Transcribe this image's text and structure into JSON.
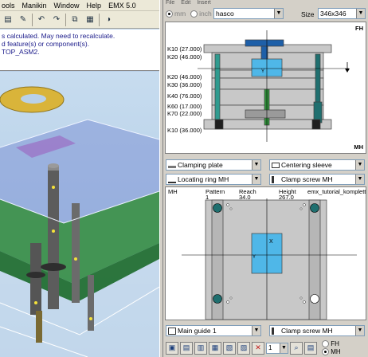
{
  "creo": {
    "menu": [
      "ools",
      "Manikin",
      "Window",
      "Help",
      "EMX 5.0"
    ],
    "messages": [
      "s calculated. May need to recalculate.",
      "d feature(s) or component(s).",
      "TOP_ASM2."
    ],
    "toolbar_icons": [
      "open-icon",
      "undo-icon",
      "redo-icon",
      "copy-icon",
      "paste-icon",
      "display-style-icon"
    ]
  },
  "emx": {
    "menu": [
      "File",
      "Edit",
      "Insert"
    ],
    "units": {
      "mm_label": "mm",
      "inch_label": "inch",
      "selected": "mm"
    },
    "supplier": "hasco",
    "size_label": "Size",
    "size_value": "346x346",
    "top_view": {
      "corner_fh": "FH",
      "corner_mh": "MH",
      "plates": [
        "K10 (27.000)",
        "K20 (46.000)",
        "K20 (46.000)",
        "K30 (36.000)",
        "K40 (76.000)",
        "K60 (17.000)",
        "K70 (22.000)",
        "K10 (36.000)"
      ]
    },
    "combos": {
      "left1": "Clamping plate",
      "right1": "Centering sleeve",
      "left2": "Locating ring MH",
      "right2": "Clamp screw MH",
      "left3": "Main guide 1",
      "right3": "Clamp screw MH"
    },
    "bottom_view": {
      "side": "MH",
      "pattern_label": "Pattern",
      "pattern_value": "1",
      "reach_label": "Reach",
      "reach_value": "34.0",
      "height_label": "Height",
      "height_value": "267.0",
      "assembly": "emx_tutorial_komplett"
    },
    "bottom_bar": {
      "number": "1",
      "fh_label": "FH",
      "mh_label": "MH",
      "selected": "MH"
    },
    "colors": {
      "plate_gray": "#c8c8c8",
      "insert_blue": "#4fb7e8",
      "guide_teal": "#1f6f6f"
    }
  }
}
